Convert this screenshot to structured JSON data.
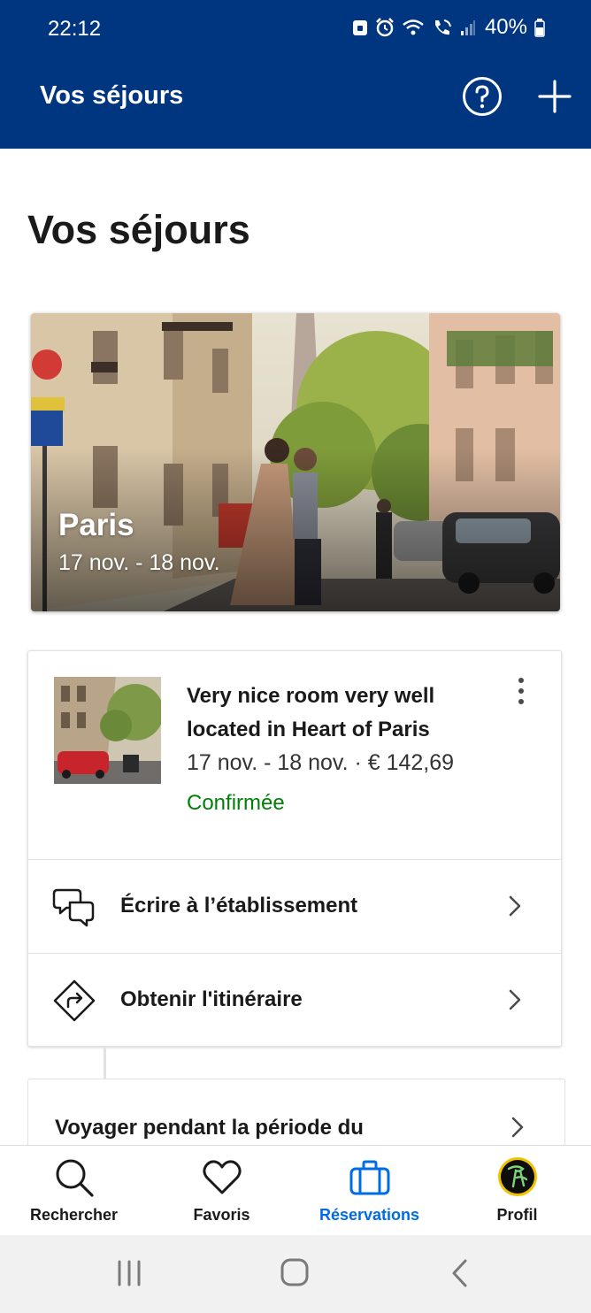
{
  "status_bar": {
    "time": "22:12",
    "battery": "40%"
  },
  "app_bar": {
    "title": "Vos séjours",
    "help_icon": "help-circle-icon",
    "add_icon": "plus-icon",
    "background": "#003580"
  },
  "page": {
    "title": "Vos séjours"
  },
  "hero": {
    "city": "Paris",
    "dates": "17 nov. - 18 nov."
  },
  "booking": {
    "name": "Very nice room very well located in Heart of Paris",
    "meta": "17 nov. - 18 nov. · € 142,69",
    "status": "Confirmée",
    "status_color": "#008009",
    "actions": [
      {
        "label": "Écrire à l’établissement",
        "icon": "chat-bubbles-icon"
      },
      {
        "label": "Obtenir l'itinéraire",
        "icon": "directions-icon"
      }
    ]
  },
  "travel_card": {
    "label": "Voyager pendant la période du"
  },
  "bottom_nav": {
    "items": [
      {
        "label": "Rechercher",
        "icon": "search-icon",
        "active": false
      },
      {
        "label": "Favoris",
        "icon": "heart-icon",
        "active": false
      },
      {
        "label": "Réservations",
        "icon": "suitcase-icon",
        "active": true
      },
      {
        "label": "Profil",
        "icon": "avatar-icon",
        "active": false
      }
    ],
    "active_color": "#006ce4"
  }
}
